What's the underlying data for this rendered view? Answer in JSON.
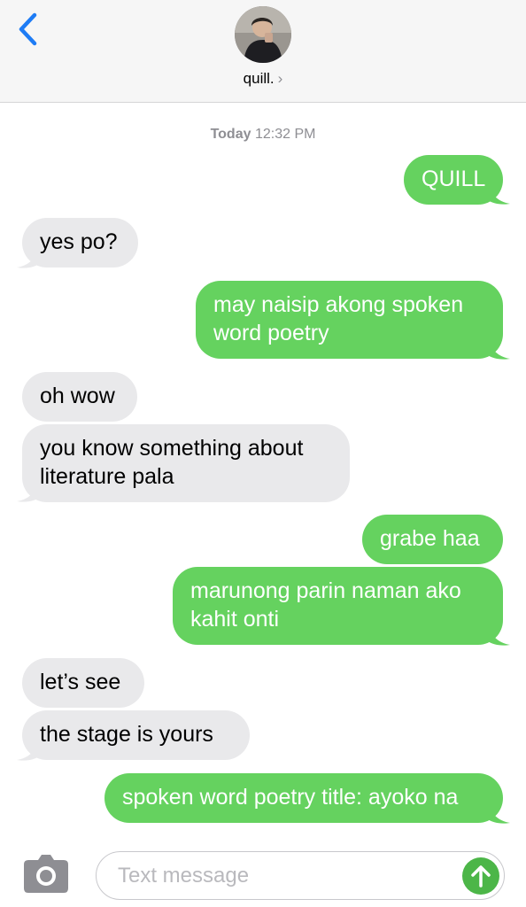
{
  "header": {
    "contact_name": "quill.",
    "chevron": "›"
  },
  "timestamp": {
    "day": "Today",
    "time": "12:32 PM"
  },
  "messages": [
    {
      "dir": "out",
      "lines": [
        "QUILL"
      ]
    },
    {
      "dir": "in",
      "lines": [
        "yes po?"
      ]
    },
    {
      "dir": "out",
      "lines": [
        "may naisip akong spoken",
        "word poetry"
      ]
    },
    {
      "dir": "in",
      "lines": [
        "oh wow"
      ]
    },
    {
      "dir": "in",
      "lines": [
        "you know something about",
        "literature pala"
      ]
    },
    {
      "dir": "out",
      "lines": [
        "grabe haa"
      ]
    },
    {
      "dir": "out",
      "lines": [
        "marunong parin naman ako",
        "kahit onti"
      ]
    },
    {
      "dir": "in",
      "lines": [
        "let’s see"
      ]
    },
    {
      "dir": "in",
      "lines": [
        "the stage is yours"
      ]
    },
    {
      "dir": "out",
      "lines": [
        "spoken word poetry title: ayoko na"
      ]
    }
  ],
  "compose": {
    "placeholder": "Text message"
  },
  "icons": {
    "back": "chevron-left-icon",
    "camera": "camera-icon",
    "send": "arrow-up-icon"
  },
  "colors": {
    "outgoing_bubble": "#65d25f",
    "incoming_bubble": "#e9e9eb",
    "accent_blue": "#1e7cf5",
    "send_button": "#4cb648"
  }
}
